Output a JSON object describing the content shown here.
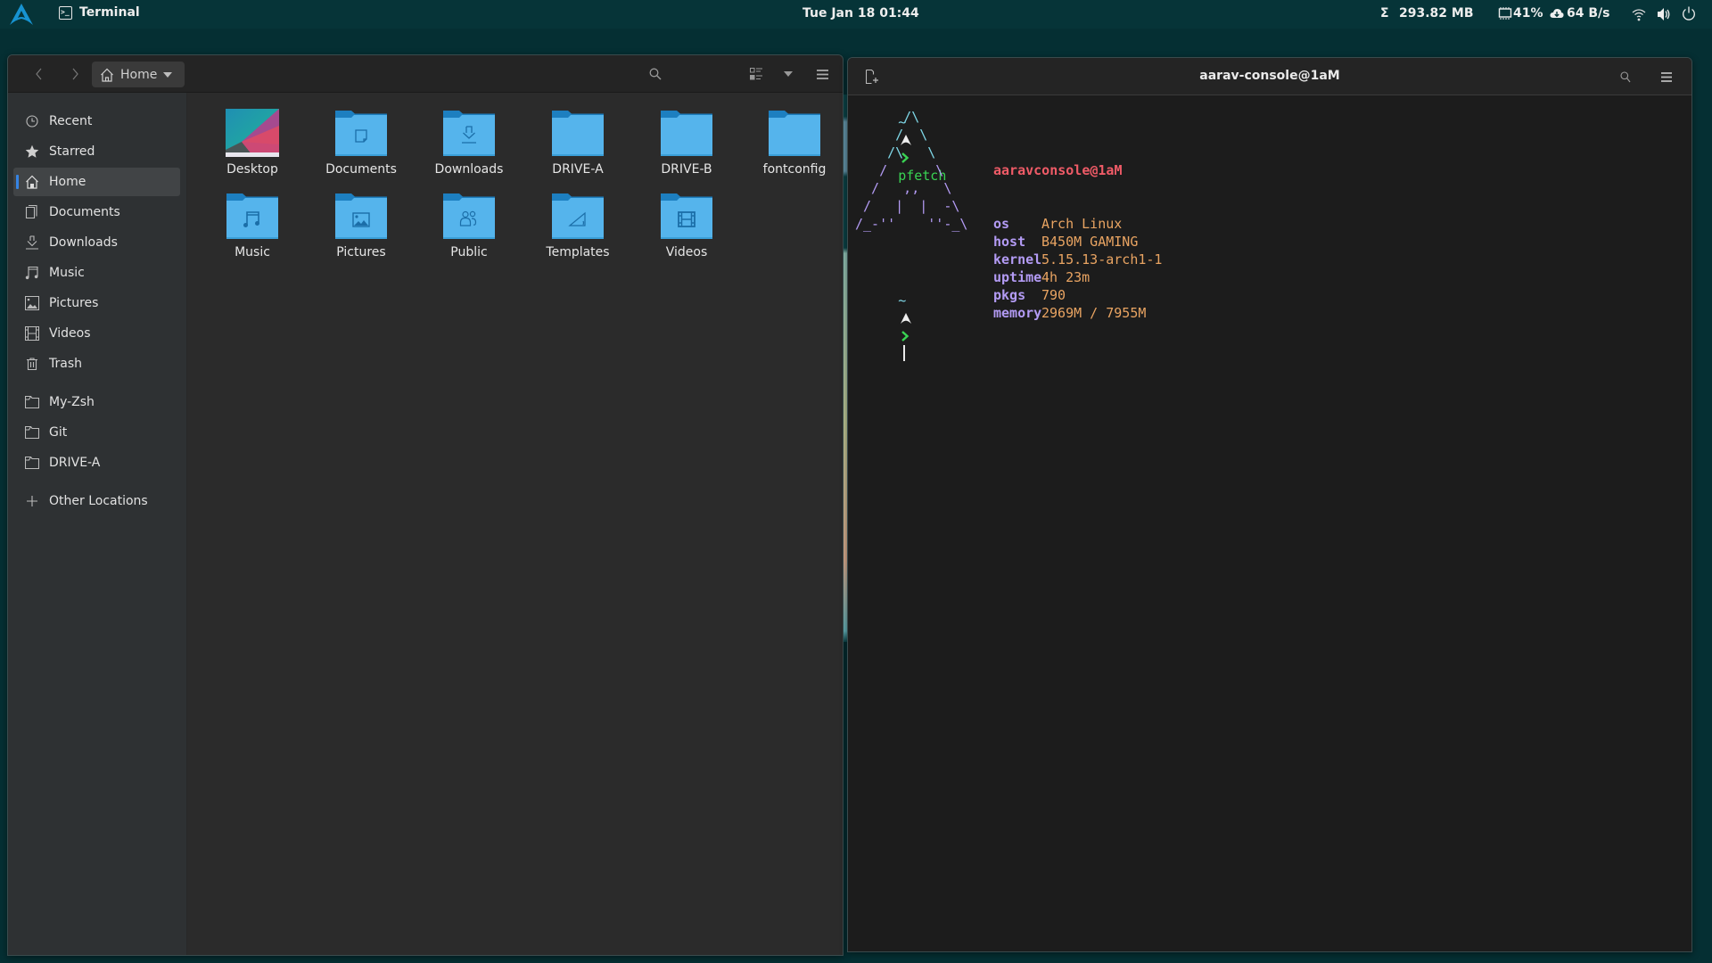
{
  "topbar": {
    "app_name": "Terminal",
    "clock": "Tue Jan 18  01:44",
    "memory_label": "293.82 MB",
    "cpu_label": "41%",
    "network_label": "64 B/s",
    "icons": [
      "arch-logo",
      "terminal-icon",
      "sigma-icon",
      "cpu-icon",
      "cloud-download-icon",
      "wifi-icon",
      "volume-icon",
      "power-icon"
    ]
  },
  "file_manager": {
    "path_label": "Home",
    "sidebar": {
      "places": [
        {
          "label": "Recent",
          "icon": "clock-icon"
        },
        {
          "label": "Starred",
          "icon": "star-icon"
        },
        {
          "label": "Home",
          "icon": "home-icon",
          "active": true
        },
        {
          "label": "Documents",
          "icon": "documents-icon"
        },
        {
          "label": "Downloads",
          "icon": "download-icon"
        },
        {
          "label": "Music",
          "icon": "music-icon"
        },
        {
          "label": "Pictures",
          "icon": "pictures-icon"
        },
        {
          "label": "Videos",
          "icon": "videos-icon"
        },
        {
          "label": "Trash",
          "icon": "trash-icon"
        }
      ],
      "bookmarks": [
        {
          "label": "My-Zsh",
          "icon": "folder-icon"
        },
        {
          "label": "Git",
          "icon": "folder-icon"
        },
        {
          "label": "DRIVE-A",
          "icon": "folder-icon"
        }
      ],
      "other_locations": "Other Locations"
    },
    "items": [
      {
        "label": "Desktop",
        "type": "desktop"
      },
      {
        "label": "Documents",
        "type": "documents"
      },
      {
        "label": "Downloads",
        "type": "downloads"
      },
      {
        "label": "DRIVE-A",
        "type": "plain"
      },
      {
        "label": "DRIVE-B",
        "type": "plain"
      },
      {
        "label": "fontconfig",
        "type": "plain"
      },
      {
        "label": "Music",
        "type": "music"
      },
      {
        "label": "Pictures",
        "type": "pictures"
      },
      {
        "label": "Public",
        "type": "public"
      },
      {
        "label": "Templates",
        "type": "templates"
      },
      {
        "label": "Videos",
        "type": "videos"
      }
    ]
  },
  "terminal": {
    "title": "aarav-console@1aM",
    "prompt_tilde": "~",
    "command": "pfetch",
    "ascii_art": [
      "      /\\",
      "     /  \\",
      "    /\\   \\",
      "   /      \\",
      "  /   ,,   \\",
      " /   |  |  -\\",
      "/_-''    ''-_\\"
    ],
    "pfetch": {
      "title": "aaravconsole@1aM",
      "fields": [
        {
          "key": "os",
          "value": "Arch Linux"
        },
        {
          "key": "host",
          "value": "B450M GAMING"
        },
        {
          "key": "kernel",
          "value": "5.15.13-arch1-1"
        },
        {
          "key": "uptime",
          "value": "4h 23m"
        },
        {
          "key": "pkgs",
          "value": "790"
        },
        {
          "key": "memory",
          "value": "2969M / 7955M"
        }
      ]
    }
  },
  "colors": {
    "desktop_bg": "#052f33",
    "accent": "#3584e4",
    "folder_light": "#55b4ec",
    "folder_dark": "#1d7fc0",
    "prompt_green": "#39d353",
    "pfetch_title": "#ef5b67",
    "pfetch_key": "#b39bf4",
    "pfetch_value": "#e9a462",
    "ascii_cyan": "#7fd8e8",
    "ascii_purple": "#b39bf4"
  }
}
